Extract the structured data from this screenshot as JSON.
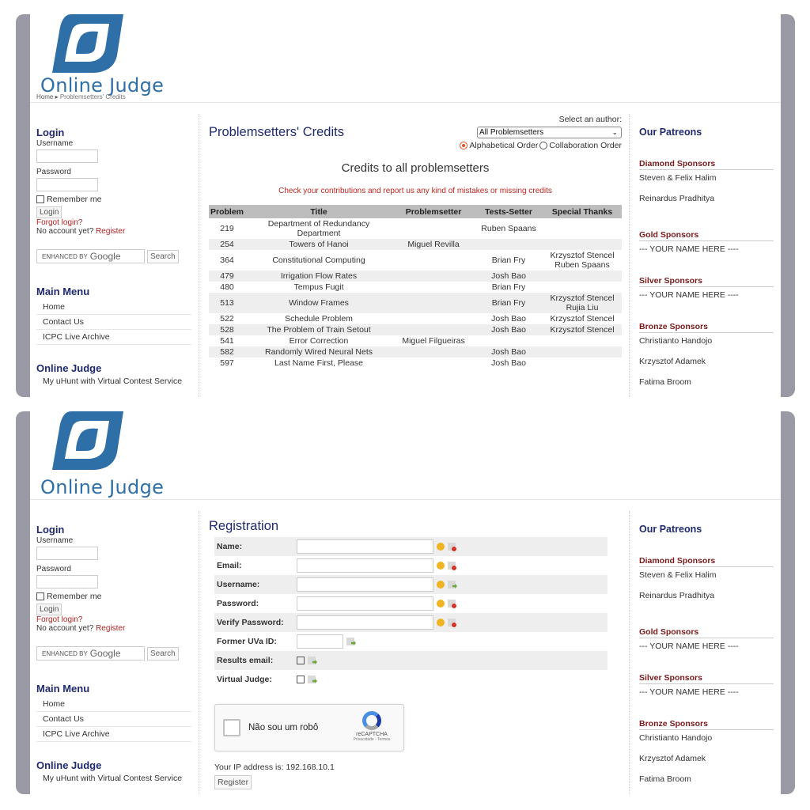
{
  "colors": {
    "title": "#1f2a6e",
    "link_red": "#b22222",
    "sponsor_heading": "#7a1a1a",
    "logo_blue": "#2f6fa8"
  },
  "logo": {
    "text": "Online Judge",
    "icon": "online-judge-logo-icon"
  },
  "breadcrumb": {
    "home": "Home",
    "current": "Problemsetters' Credits",
    "separator_icon": "triangle-right-icon"
  },
  "login": {
    "title": "Login",
    "username_label": "Username",
    "password_label": "Password",
    "remember_label": "Remember me",
    "login_button": "Login",
    "forgot": "Forgot login?",
    "no_account": "No account yet?",
    "register_link": "Register"
  },
  "search": {
    "enhanced_by": "ENHANCED BY",
    "google": "Google",
    "button": "Search"
  },
  "main_menu": {
    "title": "Main Menu",
    "items": [
      "Home",
      "Contact Us",
      "ICPC Live Archive"
    ]
  },
  "online_judge_menu": {
    "title": "Online Judge",
    "items": [
      "My uHunt with Virtual Contest Service"
    ]
  },
  "patreons": {
    "title": "Our Patreons",
    "diamond": {
      "heading": "Diamond Sponsors",
      "names": [
        "Steven & Felix Halim",
        "Reinardus Pradhitya"
      ]
    },
    "gold": {
      "heading": "Gold Sponsors",
      "names": [
        "--- YOUR NAME HERE ----"
      ]
    },
    "silver": {
      "heading": "Silver Sponsors",
      "names": [
        "--- YOUR NAME HERE ----"
      ]
    },
    "bronze": {
      "heading": "Bronze Sponsors",
      "names": [
        "Christianto Handojo",
        "Krzysztof Adamek",
        "Fatima Broom"
      ]
    }
  },
  "credits": {
    "title": "Problemsetters' Credits",
    "select_label": "Select an author:",
    "select_value": "All Problemsetters",
    "order_alpha": "Alphabetical Order",
    "order_collab": "Collaboration Order",
    "subtitle": "Credits to all problemsetters",
    "note": "Check your contributions and report us any kind of mistakes or missing credits",
    "columns": [
      "Problem",
      "Title",
      "Problemsetter",
      "Tests-Setter",
      "Special Thanks"
    ],
    "rows": [
      [
        "219",
        "Department of Redundancy Department",
        "",
        "Ruben Spaans",
        ""
      ],
      [
        "254",
        "Towers of Hanoi",
        "Miguel Revilla",
        "",
        ""
      ],
      [
        "364",
        "Constitutional Computing",
        "",
        "Brian Fry",
        "Krzysztof Stencel Ruben Spaans"
      ],
      [
        "479",
        "Irrigation Flow Rates",
        "",
        "Josh Bao",
        ""
      ],
      [
        "480",
        "Tempus Fugit",
        "",
        "Brian Fry",
        ""
      ],
      [
        "513",
        "Window Frames",
        "",
        "Brian Fry",
        "Krzysztof Stencel Rujia Liu"
      ],
      [
        "522",
        "Schedule Problem",
        "",
        "Josh Bao",
        "Krzysztof Stencel"
      ],
      [
        "528",
        "The Problem of Train Setout",
        "",
        "Josh Bao",
        "Krzysztof Stencel"
      ],
      [
        "541",
        "Error Correction",
        "Miguel Filgueiras",
        "",
        ""
      ],
      [
        "582",
        "Randomly Wired Neural Nets",
        "",
        "Josh Bao",
        ""
      ],
      [
        "597",
        "Last Name First, Please",
        "",
        "Josh Bao",
        ""
      ]
    ]
  },
  "registration": {
    "title": "Registration",
    "fields": [
      {
        "label": "Name:",
        "kind": "text",
        "icons": [
          "help-icon",
          "status-error-icon"
        ]
      },
      {
        "label": "Email:",
        "kind": "text",
        "icons": [
          "help-icon",
          "status-error-icon"
        ]
      },
      {
        "label": "Username:",
        "kind": "text",
        "icons": [
          "help-icon",
          "status-ok-icon"
        ]
      },
      {
        "label": "Password:",
        "kind": "text",
        "icons": [
          "help-icon",
          "status-error-icon"
        ]
      },
      {
        "label": "Verify Password:",
        "kind": "text",
        "icons": [
          "help-icon",
          "status-error-icon"
        ]
      },
      {
        "label": "Former UVa ID:",
        "kind": "small",
        "icons": [
          "status-ok-icon"
        ]
      },
      {
        "label": "Results email:",
        "kind": "checkbox",
        "icons": [
          "status-ok-icon"
        ]
      },
      {
        "label": "Virtual Judge:",
        "kind": "checkbox",
        "icons": [
          "status-ok-icon"
        ]
      }
    ],
    "captcha": {
      "text": "Não sou um robô",
      "brand": "reCAPTCHA",
      "terms": "Privacidade - Termos"
    },
    "ip_text": "Your IP address is: 192.168.10.1",
    "submit": "Register"
  }
}
